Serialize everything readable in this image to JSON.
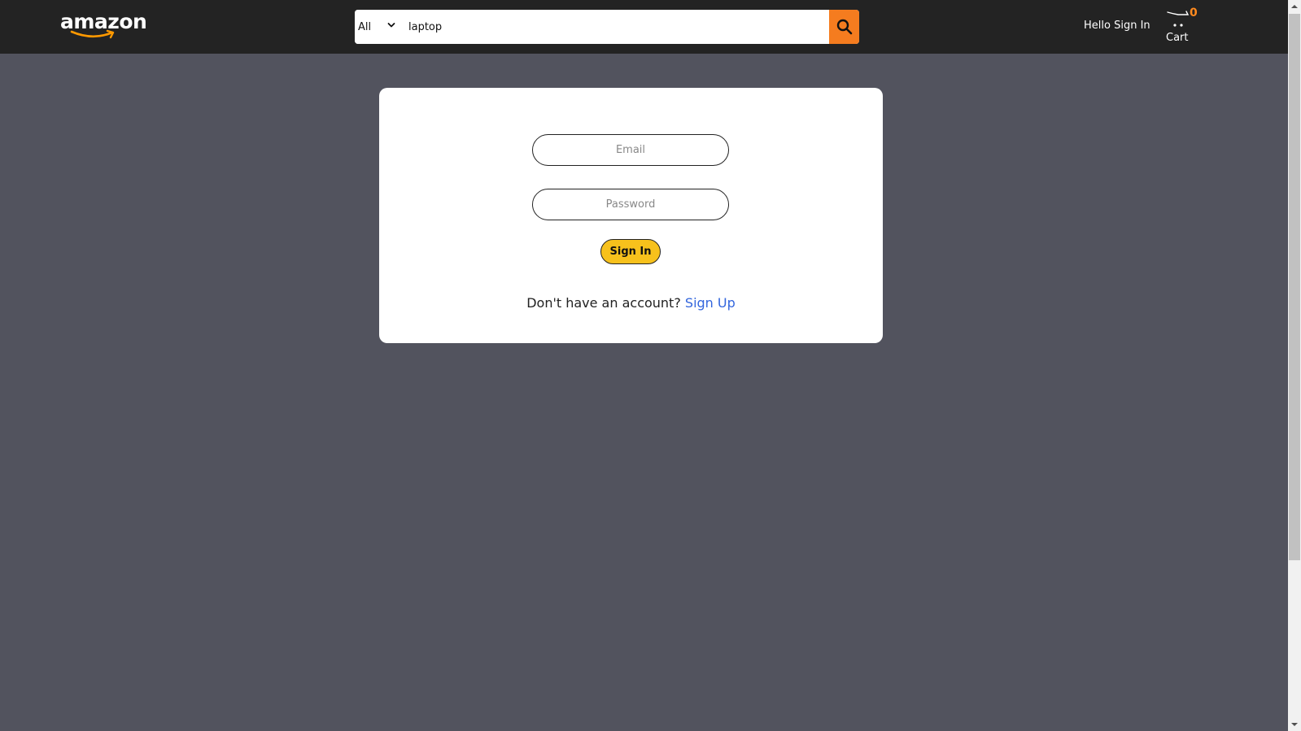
{
  "header": {
    "logo_text": "amazon",
    "search": {
      "category": "All",
      "value": "laptop",
      "button_icon": "search-icon"
    },
    "signin_text": "Hello Sign In",
    "cart": {
      "count": "0",
      "label": "Cart",
      "icon": "cart-icon"
    }
  },
  "form": {
    "email_placeholder": "Email",
    "password_placeholder": "Password",
    "signin_button": "Sign In",
    "signup_prompt": "Don't have an account?",
    "signup_link": "Sign Up"
  },
  "colors": {
    "header_bg": "#232323",
    "page_bg": "#52535e",
    "search_button": "#f57c1f",
    "signin_button": "#f7c11c",
    "cart_count": "#ff8a1e",
    "link": "#3366dd"
  }
}
